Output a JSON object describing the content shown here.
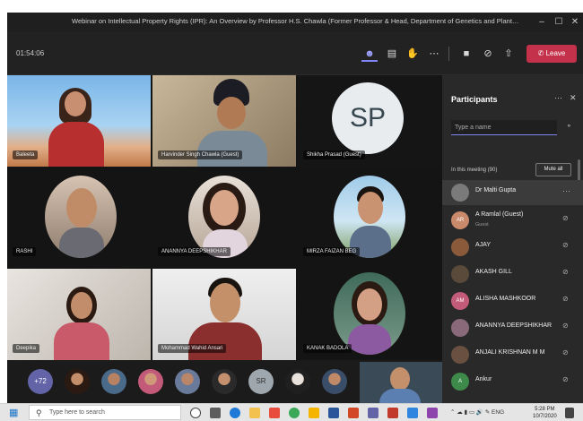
{
  "window": {
    "title": "Webinar on Intellectual Property Rights (IPR): An Overview by Professor H.S. Chawla (Former Professor & Head, Department of Genetics and Plant Breeding, G...",
    "minimize_icon": "minimize-icon",
    "maximize_icon": "maximize-icon",
    "close_icon": "close-icon"
  },
  "meeting_toolbar": {
    "timer": "01:54:06",
    "leave_label": "Leave",
    "leave_color": "#c4314b"
  },
  "tiles": [
    {
      "name": "Baleeta"
    },
    {
      "name": "Harvinder Singh Chawla (Guest)"
    },
    {
      "name": "Shikha Prasad (Guest)",
      "initials": "SP"
    },
    {
      "name": "RASHI"
    },
    {
      "name": "ANANNYA DEEPSHIKHAR"
    },
    {
      "name": "MIRZA FAIZAN BEG"
    },
    {
      "name": "Deepika"
    },
    {
      "name": "Mohammad Wahid Ansari"
    },
    {
      "name": "KANAK BADOLA"
    }
  ],
  "strip": {
    "more_count": "+72",
    "sr_initials": "SR"
  },
  "participants": {
    "title": "Participants",
    "search_placeholder": "Type a name",
    "in_meeting": "In this meeting (90)",
    "mute_all": "Mute all",
    "list": [
      {
        "name": "Dr Malti Gupta",
        "sub": "",
        "initials": "",
        "color": "#7a7a7a"
      },
      {
        "name": "A Ramlal (Guest)",
        "sub": "Guest",
        "initials": "AR",
        "color": "#c98a6b"
      },
      {
        "name": "AJAY",
        "sub": "",
        "initials": "",
        "color": "#8a5a3a"
      },
      {
        "name": "AKASH GILL",
        "sub": "",
        "initials": "",
        "color": "#5a4a3a"
      },
      {
        "name": "ALISHA MASHKOOR",
        "sub": "",
        "initials": "AM",
        "color": "#c25b7a"
      },
      {
        "name": "ANANNYA DEEPSHIKHAR",
        "sub": "",
        "initials": "",
        "color": "#8a6a7a"
      },
      {
        "name": "ANJALI KRISHNAN M M",
        "sub": "",
        "initials": "",
        "color": "#6a5040"
      },
      {
        "name": "Ankur",
        "sub": "",
        "initials": "A",
        "color": "#3e8a4a"
      }
    ],
    "accent": "#7f85f5"
  },
  "taskbar": {
    "search_text": "Type here to search",
    "lang": "ENG",
    "time": "5:28 PM",
    "date": "10/7/2020"
  }
}
